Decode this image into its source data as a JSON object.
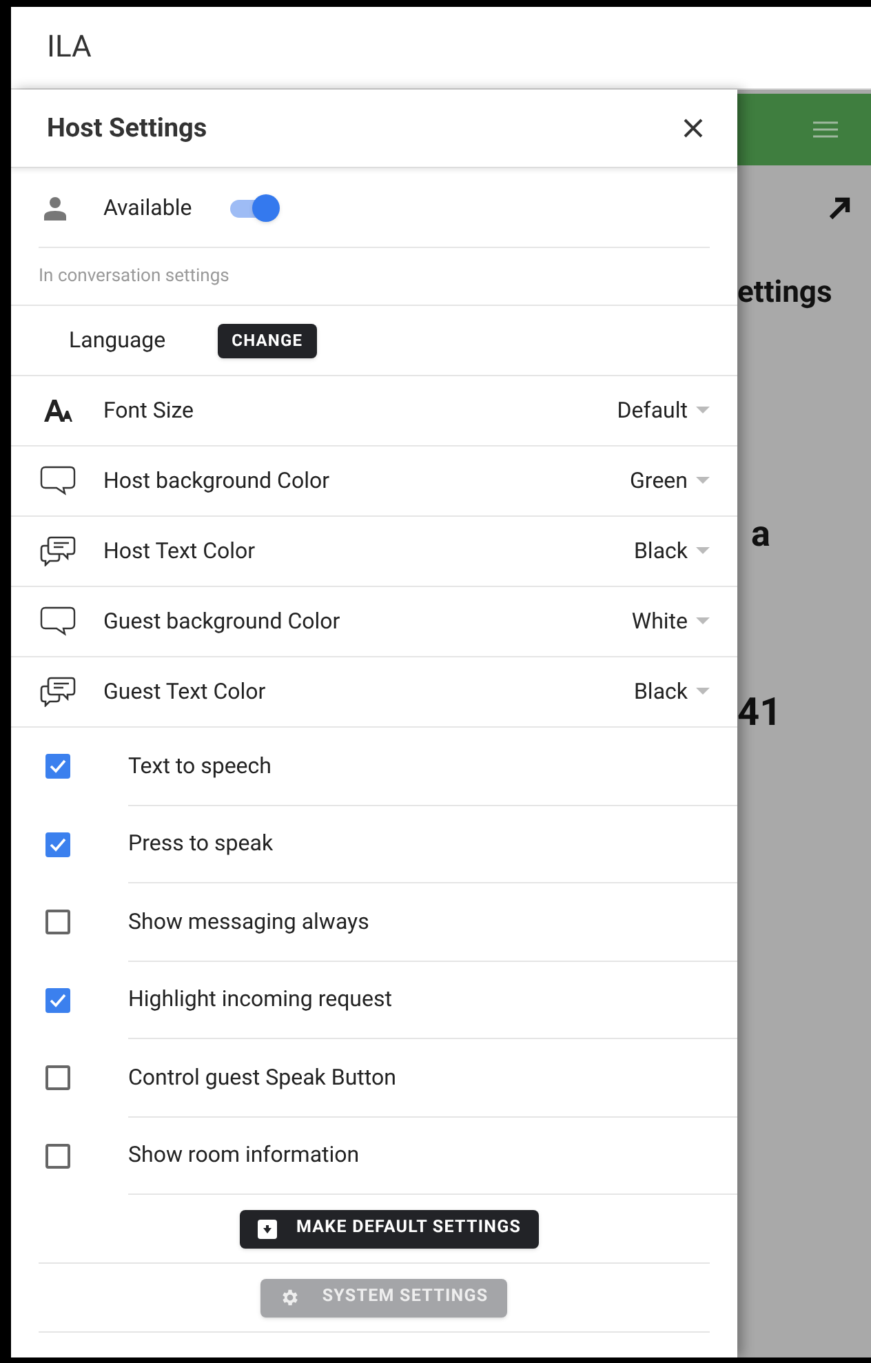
{
  "app_bar": {
    "title": "ILA"
  },
  "background": {
    "texts": [
      "ettings",
      "a",
      "41"
    ]
  },
  "drawer": {
    "title": "Host Settings",
    "available": {
      "label": "Available",
      "on": true
    },
    "section_label": "In conversation settings",
    "language": {
      "label": "Language",
      "button": "CHANGE"
    },
    "selects": [
      {
        "kind": "font",
        "label": "Font Size",
        "value": "Default"
      },
      {
        "kind": "bubble",
        "label": "Host background Color",
        "value": "Green"
      },
      {
        "kind": "chat",
        "label": "Host Text Color",
        "value": "Black"
      },
      {
        "kind": "bubble",
        "label": "Guest background Color",
        "value": "White"
      },
      {
        "kind": "chat",
        "label": "Guest Text Color",
        "value": "Black"
      }
    ],
    "checkboxes": [
      {
        "label": "Text to speech",
        "checked": true
      },
      {
        "label": "Press to speak",
        "checked": true
      },
      {
        "label": "Show messaging always",
        "checked": false
      },
      {
        "label": "Highlight incoming request",
        "checked": true
      },
      {
        "label": "Control guest Speak Button",
        "checked": false
      },
      {
        "label": "Show room information",
        "checked": false
      }
    ],
    "make_default_button": {
      "label": "MAKE DEFAULT SETTINGS",
      "disabled": false
    },
    "system_settings_button": {
      "label": "SYSTEM SETTINGS",
      "disabled": true
    }
  }
}
